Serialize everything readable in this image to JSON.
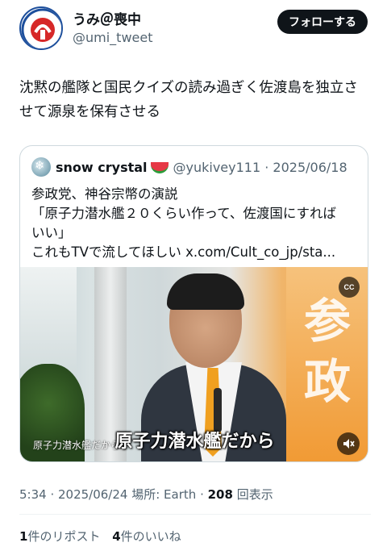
{
  "author": {
    "name": "うみ＠喪中",
    "handle": "@umi_tweet",
    "follow_label": "フォローする"
  },
  "tweet": {
    "text": "沈黙の艦隊と国民クイズの読み過ぎく佐渡島を独立させて源泉を保有させる"
  },
  "quote": {
    "name": "snow crystal",
    "handle_date": "@yukivey111 · 2025/06/18",
    "lines": [
      "参政党、神谷宗幣の演説",
      "「原子力潜水艦２０くらい作って、佐渡国にすれば",
      "いい」",
      "これもTVで流してほしい x.com/Cult_co_jp/sta..."
    ],
    "video": {
      "subtitle": "原子力潜水艦だから",
      "small_caption": "原子力潜水艦だから",
      "cc_label": "CC",
      "banner_chars": [
        "参",
        "政"
      ]
    }
  },
  "meta": {
    "time_date": "5:34 · 2025/06/24",
    "location": "場所: Earth",
    "view_count": "208",
    "view_label": "回表示"
  },
  "stats": {
    "reposts_count": "1",
    "reposts_label": "件のリポスト",
    "likes_count": "4",
    "likes_label": "件のいいね"
  }
}
